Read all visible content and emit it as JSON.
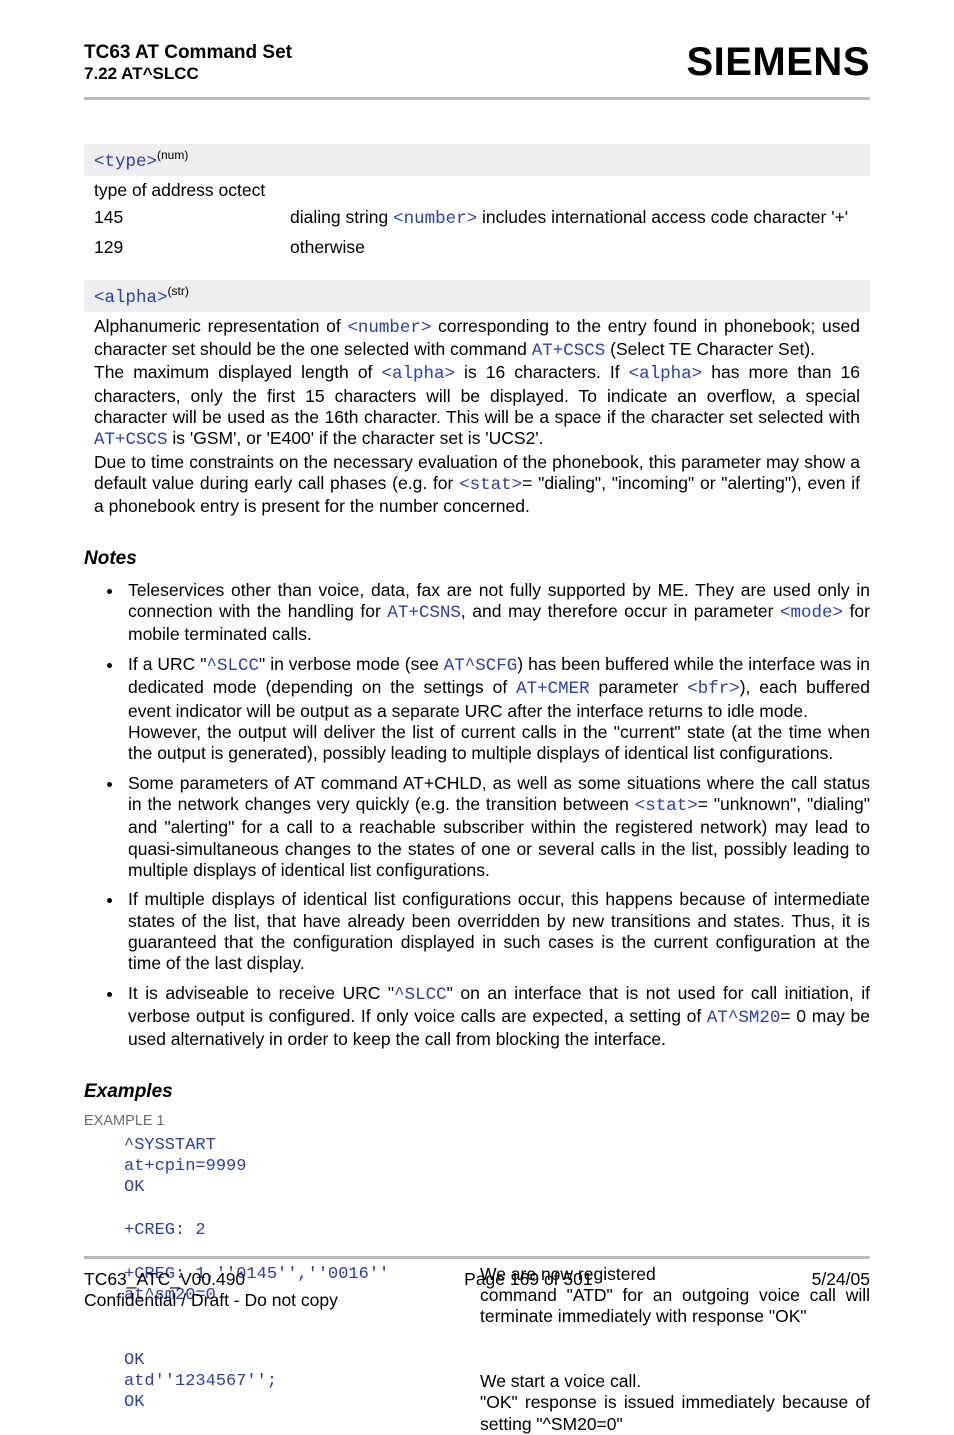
{
  "header": {
    "title": "TC63 AT Command Set",
    "section": "7.22 AT^SLCC",
    "brand": "SIEMENS"
  },
  "param_type": {
    "tag": "<type>",
    "sup": "(num)",
    "desc": "type of address octect",
    "rows": [
      {
        "key": "145",
        "val_pre": "dialing string ",
        "val_code": "<number>",
        "val_post": " includes international access code character '+'"
      },
      {
        "key": "129",
        "val_pre": "otherwise",
        "val_code": "",
        "val_post": ""
      }
    ]
  },
  "param_alpha": {
    "tag": "<alpha>",
    "sup": "(str)",
    "body_parts": {
      "p1a": "Alphanumeric representation of ",
      "p1_code1": "<number>",
      "p1b": " corresponding to the entry found in phonebook; used character set should be the one selected with command ",
      "p1_code2": "AT+CSCS",
      "p1c": " (Select TE Character Set).",
      "p2a": "The maximum displayed length of ",
      "p2_code1": "<alpha>",
      "p2b": " is 16 characters. If ",
      "p2_code2": "<alpha>",
      "p2c": " has more than 16 characters, only the first 15 characters will be displayed. To indicate an overflow, a special character will be used as the 16th character. This will be a space if the character set selected with ",
      "p2_code3": "AT+CSCS",
      "p2d": " is 'GSM', or 'E400' if the character set is 'UCS2'.",
      "p3a": "Due to time constraints on the necessary evaluation of the phonebook, this parameter may show a default value during early call phases (e.g. for ",
      "p3_code1": "<stat>",
      "p3b": "= \"dialing\", \"incoming\" or \"alerting\"), even if a phonebook entry is present for the number concerned."
    }
  },
  "notes_title": "Notes",
  "notes": {
    "n1a": "Teleservices other than voice, data, fax are not fully supported by ME. They are used only in connection with the handling for ",
    "n1_c1": "AT+CSNS",
    "n1b": ", and may therefore occur in parameter ",
    "n1_c2": "<mode>",
    "n1c": " for mobile terminated calls.",
    "n2a": "If a URC \"",
    "n2_c1": "^SLCC",
    "n2b": "\" in verbose mode (see ",
    "n2_c2": "AT^SCFG",
    "n2c": ") has been buffered while the interface was in dedicated mode (depending on the settings of ",
    "n2_c3": "AT+CMER",
    "n2d": " parameter ",
    "n2_c4": "<bfr>",
    "n2e": "), each buffered event indicator will be output as a separate URC after the interface returns to idle mode.",
    "n2f": "However, the output will deliver the list of current calls in the \"current\" state (at the time when the output is generated), possibly leading to multiple displays of identical list configurations.",
    "n3a": "Some parameters of AT command AT+CHLD, as well as some situations where the call status in the network changes very quickly (e.g. the transition between ",
    "n3_c1": "<stat>",
    "n3b": "= \"unknown\", \"dialing\" and \"alerting\" for a call to a reachable subscriber within the registered network) may lead to quasi-simultaneous changes to the states of one or several calls in the list, possibly leading to multiple displays of identical list configurations.",
    "n4": "If multiple displays of identical list configurations occur, this happens because of intermediate states of the list, that have already been overridden by new transitions and states. Thus, it is guaranteed that the configuration displayed in such cases is the current configuration at the time of the last display.",
    "n5a": "It is adviseable to receive URC \"",
    "n5_c1": "^SLCC",
    "n5b": "\" on an interface that is not used for call initiation, if verbose output is configured. If only voice calls are expected, a setting of ",
    "n5_c2": "AT^SM20",
    "n5c": "= 0 may be used alternatively in order to keep the call from blocking the interface."
  },
  "examples_title": "Examples",
  "example_label": "EXAMPLE 1",
  "example": {
    "l1": "^SYSSTART",
    "l2": "at+cpin=9999",
    "l3": "OK",
    "l4": "+CREG: 2",
    "l5": "+CREG: 1,''0145'',''0016''",
    "r5": "We are now registered",
    "l6": "at^sm20=0",
    "r6": "command \"ATD\" for an outgoing voice call will terminate immediately with response \"OK\"",
    "l7": "OK",
    "l8": "atd''1234567'';",
    "r8": "We start a voice call.",
    "l9": "OK",
    "r9": "\"OK\" response is issued immediately because of setting \"^SM20=0\""
  },
  "footer": {
    "left": "TC63_ATC_V00.490",
    "center": "Page 169 of 501",
    "right": "5/24/05",
    "left2": "Confidential / Draft - Do not copy"
  }
}
